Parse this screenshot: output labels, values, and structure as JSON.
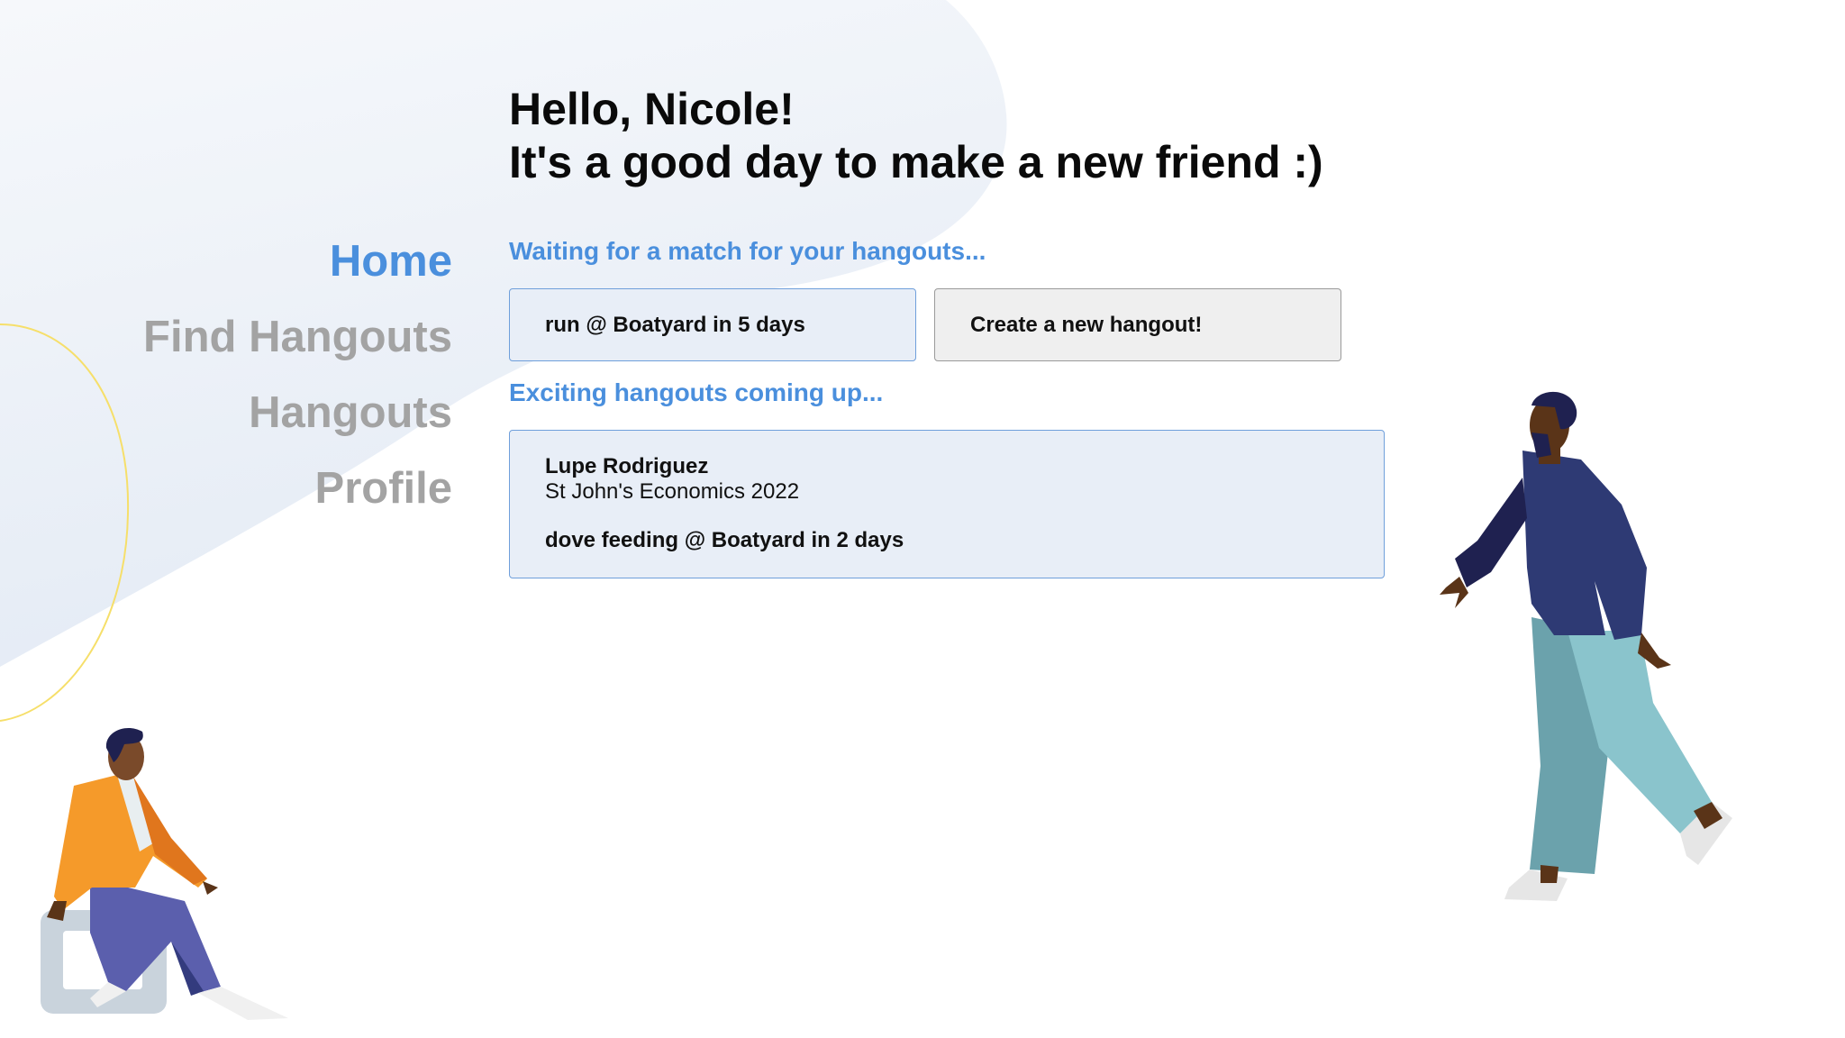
{
  "greeting": {
    "line1": "Hello, Nicole!",
    "line2": "It's a good day to make a new friend :)"
  },
  "nav": {
    "items": [
      {
        "label": "Home",
        "active": true
      },
      {
        "label": "Find Hangouts",
        "active": false
      },
      {
        "label": "Hangouts",
        "active": false
      },
      {
        "label": "Profile",
        "active": false
      }
    ]
  },
  "waiting": {
    "title": "Waiting for a match for your hangouts...",
    "pending_hangout": "run @ Boatyard in 5 days",
    "create_button": "Create a new hangout!"
  },
  "upcoming": {
    "title": "Exciting hangouts coming up...",
    "items": [
      {
        "name": "Lupe Rodriguez",
        "detail": "St John's Economics 2022",
        "activity": "dove feeding @ Boatyard in 2 days"
      }
    ]
  },
  "colors": {
    "accent": "#4a8fdd",
    "nav_inactive": "#a3a3a3",
    "card_bg": "#e8eef7",
    "card_border": "#6f9fdb",
    "button_bg": "#efefef"
  },
  "illustrations": [
    "seated-person-illustration",
    "walking-person-illustration"
  ]
}
